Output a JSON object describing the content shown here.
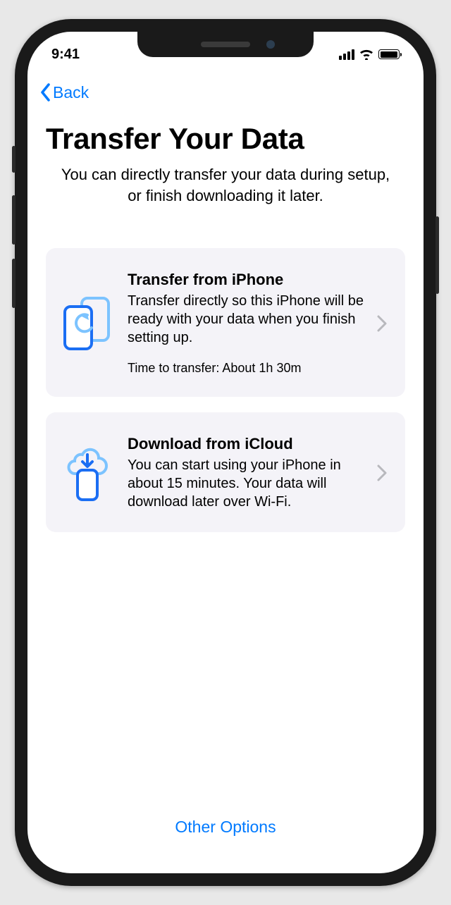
{
  "statusBar": {
    "time": "9:41"
  },
  "nav": {
    "back": "Back"
  },
  "header": {
    "title": "Transfer Your Data",
    "subtitle": "You can directly transfer your data during setup, or finish downloading it later."
  },
  "options": [
    {
      "title": "Transfer from iPhone",
      "description": "Transfer directly so this iPhone will be ready with your data when you finish setting up.",
      "meta": "Time to transfer: About 1h 30m"
    },
    {
      "title": "Download from iCloud",
      "description": "You can start using your iPhone in about 15 minutes. Your data will download later over Wi-Fi."
    }
  ],
  "footer": {
    "otherOptions": "Other Options"
  },
  "colors": {
    "accent": "#007aff",
    "iconLight": "#7cc3ff",
    "iconDark": "#1b6ef3",
    "cardBg": "#f4f3f8"
  }
}
